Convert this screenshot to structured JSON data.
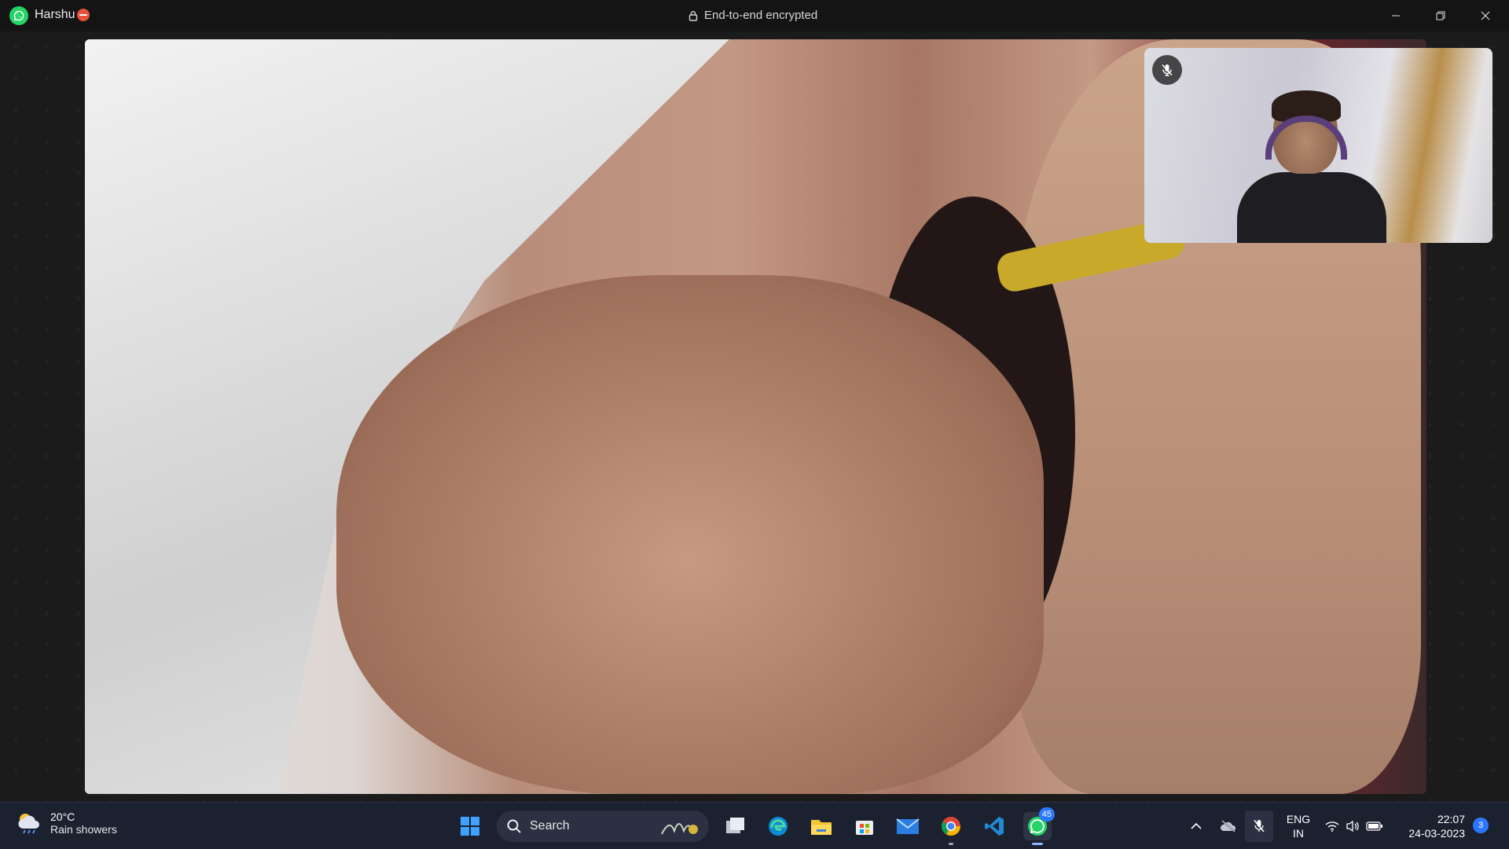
{
  "titlebar": {
    "contact_name": "Harshu",
    "encryption_text": "End-to-end encrypted",
    "icons": {
      "app": "whatsapp-icon",
      "lock": "lock-icon",
      "minimize": "minimize-icon",
      "maximize": "restore-icon",
      "close": "close-icon"
    }
  },
  "call": {
    "self_muted": true,
    "icons": {
      "self_mic": "mic-off-icon"
    }
  },
  "taskbar": {
    "weather": {
      "temp": "20°C",
      "desc": "Rain showers"
    },
    "search": {
      "label": "Search"
    },
    "apps": [
      {
        "name": "start",
        "icon": "windows-icon"
      },
      {
        "name": "task-view",
        "icon": "task-view-icon"
      },
      {
        "name": "edge",
        "icon": "edge-icon"
      },
      {
        "name": "file-explorer",
        "icon": "folder-icon"
      },
      {
        "name": "store",
        "icon": "store-icon"
      },
      {
        "name": "mail",
        "icon": "mail-icon"
      },
      {
        "name": "chrome",
        "icon": "chrome-icon"
      },
      {
        "name": "vscode",
        "icon": "vscode-icon"
      },
      {
        "name": "whatsapp",
        "icon": "whatsapp-icon",
        "badge": "45",
        "active": true
      }
    ],
    "tray": {
      "lang_top": "ENG",
      "lang_bottom": "IN",
      "time": "22:07",
      "date": "24-03-2023",
      "notifications": "3"
    }
  }
}
